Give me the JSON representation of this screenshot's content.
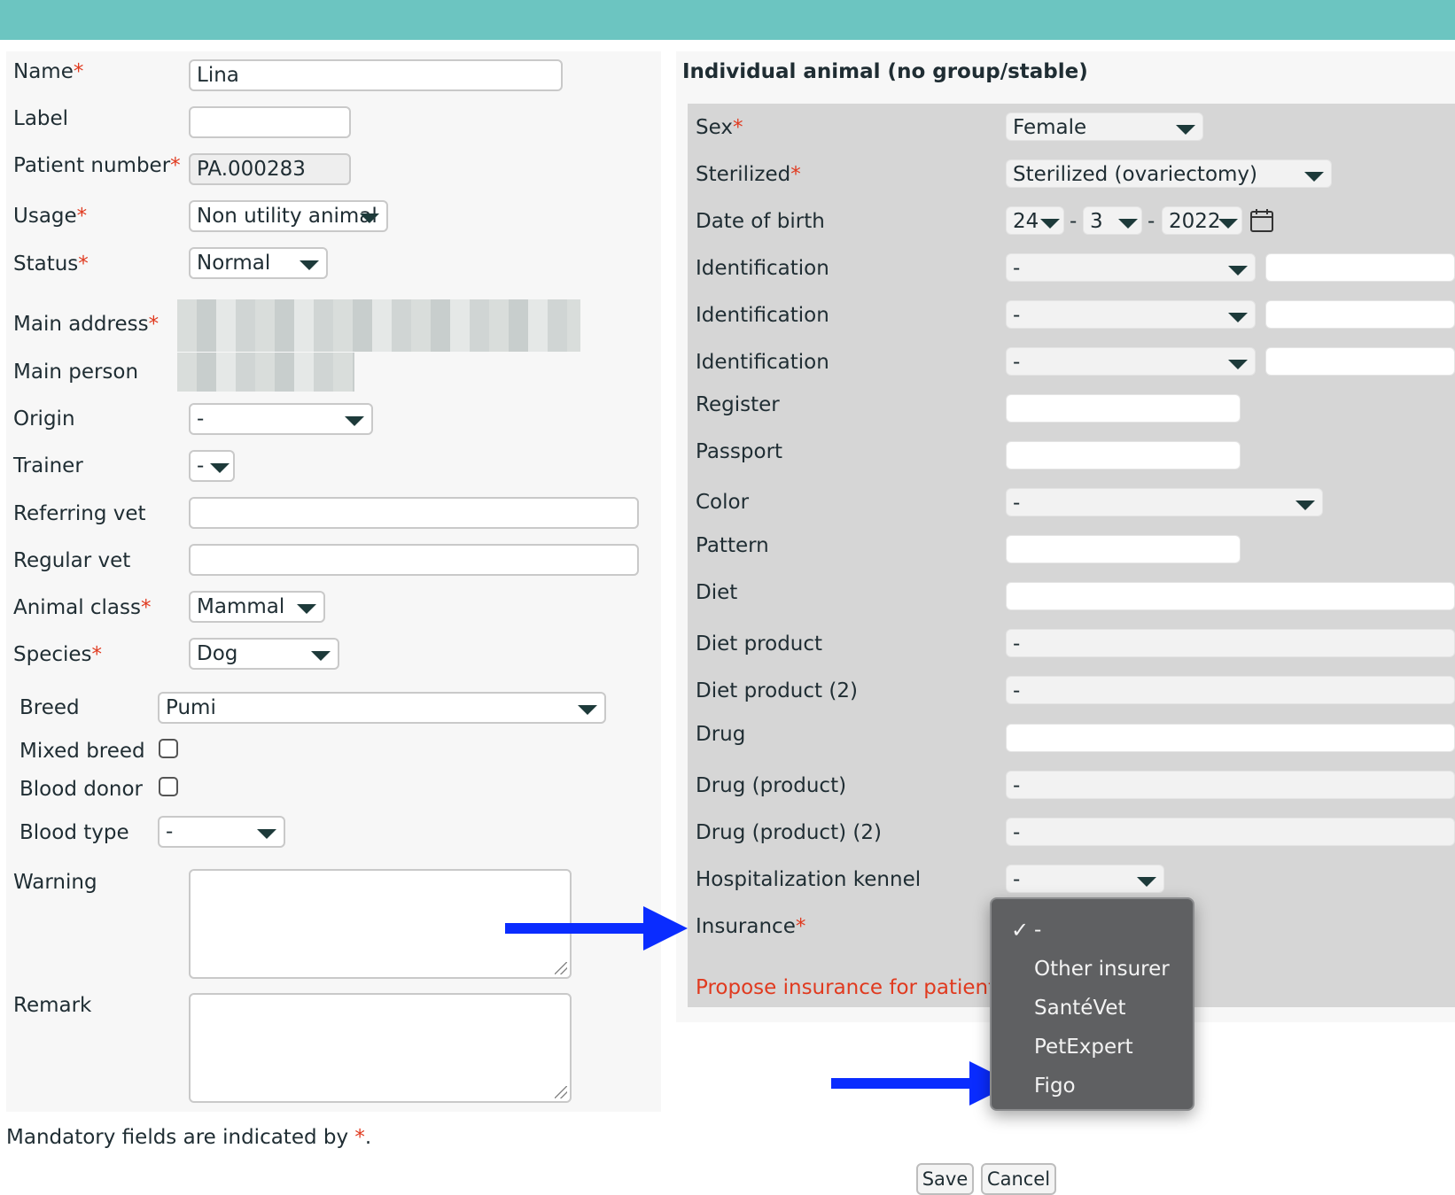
{
  "left_form": {
    "name_label": "Name",
    "name_value": "Lina",
    "label_label": "Label",
    "label_value": "",
    "patient_number_label": "Patient number",
    "patient_number_value": "PA.000283",
    "usage_label": "Usage",
    "usage_value": "Non utility animal",
    "status_label": "Status",
    "status_value": "Normal",
    "main_address_label": "Main address",
    "main_person_label": "Main person",
    "origin_label": "Origin",
    "origin_value": "-",
    "trainer_label": "Trainer",
    "trainer_value": "-",
    "referring_vet_label": "Referring vet",
    "referring_vet_value": "",
    "regular_vet_label": "Regular vet",
    "regular_vet_value": "",
    "animal_class_label": "Animal class",
    "animal_class_value": "Mammal",
    "species_label": "Species",
    "species_value": "Dog",
    "breed_label": "Breed",
    "breed_value": "Pumi",
    "mixed_breed_label": "Mixed breed",
    "blood_donor_label": "Blood donor",
    "blood_type_label": "Blood type",
    "blood_type_value": "-",
    "warning_label": "Warning",
    "remark_label": "Remark"
  },
  "required_marker": "*",
  "right_form": {
    "section_title": "Individual animal (no group/stable)",
    "sex_label": "Sex",
    "sex_value": "Female",
    "sterilized_label": "Sterilized",
    "sterilized_value": "Sterilized (ovariectomy)",
    "dob_label": "Date of birth",
    "dob_day": "24",
    "dob_month": "3",
    "dob_year": "2022",
    "dob_separator": "-",
    "identification_label": "Identification",
    "identification_value": "-",
    "register_label": "Register",
    "passport_label": "Passport",
    "color_label": "Color",
    "color_value": "-",
    "pattern_label": "Pattern",
    "diet_label": "Diet",
    "diet_product_label": "Diet product",
    "diet_product_value": "-",
    "diet_product2_label": "Diet product (2)",
    "diet_product2_value": "-",
    "drug_label": "Drug",
    "drug_product_label": "Drug (product)",
    "drug_product_value": "-",
    "drug_product2_label": "Drug (product) (2)",
    "drug_product2_value": "-",
    "hospitalization_label": "Hospitalization kennel",
    "hospitalization_value": "-",
    "insurance_label": "Insurance",
    "propose_link": "Propose insurance for patient"
  },
  "insurance_dropdown": {
    "check_mark": "✓",
    "options": [
      "-",
      "Other insurer",
      "SantéVet",
      "PetExpert",
      "Figo"
    ],
    "selected_index": 0
  },
  "footer": {
    "mandatory_text": "Mandatory fields are indicated by ",
    "mandatory_end": ".",
    "save_label": "Save",
    "cancel_label": "Cancel"
  },
  "colors": {
    "top_bar": "#6cc5c1",
    "required": "#e03a1f",
    "annotation_arrow": "#0a2cff",
    "dropdown_bg": "#5f6062"
  },
  "icons": {
    "calendar": "calendar-icon",
    "caret": "chevron-down-icon"
  }
}
